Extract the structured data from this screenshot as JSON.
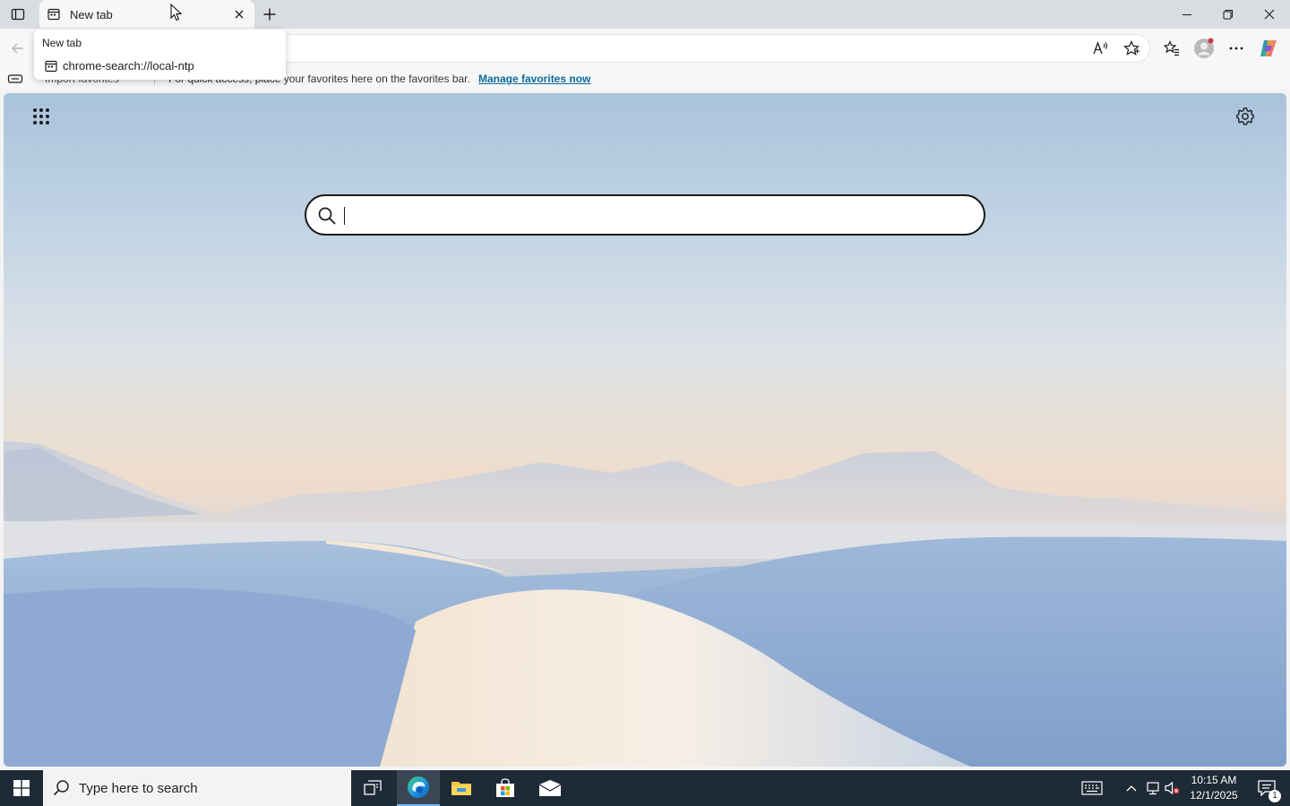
{
  "browser": {
    "tab": {
      "title": "New tab"
    },
    "hovercard": {
      "title": "New tab",
      "url": "chrome-search://local-ntp"
    },
    "address": {
      "value": ""
    }
  },
  "favorites_bar": {
    "import_label": "Import favorites",
    "hint": "For quick access, place your favorites here on the favorites bar.",
    "manage_link": "Manage favorites now"
  },
  "ntp": {
    "search": {
      "value": "",
      "placeholder": ""
    }
  },
  "taskbar": {
    "search_placeholder": "Type here to search",
    "clock_time": "10:15 AM",
    "clock_date": "12/1/2025",
    "notification_count": "1"
  },
  "colors": {
    "accent_link": "#0b6a9e",
    "taskbar_bg": "#1f2a37",
    "titlebar_bg": "#d9dce1",
    "edge_blue": "#1f7fd8",
    "edge_green": "#3ecf6b"
  },
  "icons": [
    "tab-actions-icon",
    "page-icon",
    "close-icon",
    "plus-icon",
    "minimize-icon",
    "restore-icon",
    "back-arrow-icon",
    "read-aloud-icon",
    "star-icon",
    "favorites-icon",
    "profile-icon",
    "more-icon",
    "copilot-icon",
    "apps-grid-icon",
    "gear-icon",
    "search-icon",
    "windows-logo-icon",
    "task-view-icon",
    "edge-icon",
    "file-explorer-icon",
    "store-icon",
    "mail-icon",
    "keyboard-icon",
    "chevron-up-icon",
    "network-icon",
    "volume-muted-icon",
    "notification-icon"
  ]
}
